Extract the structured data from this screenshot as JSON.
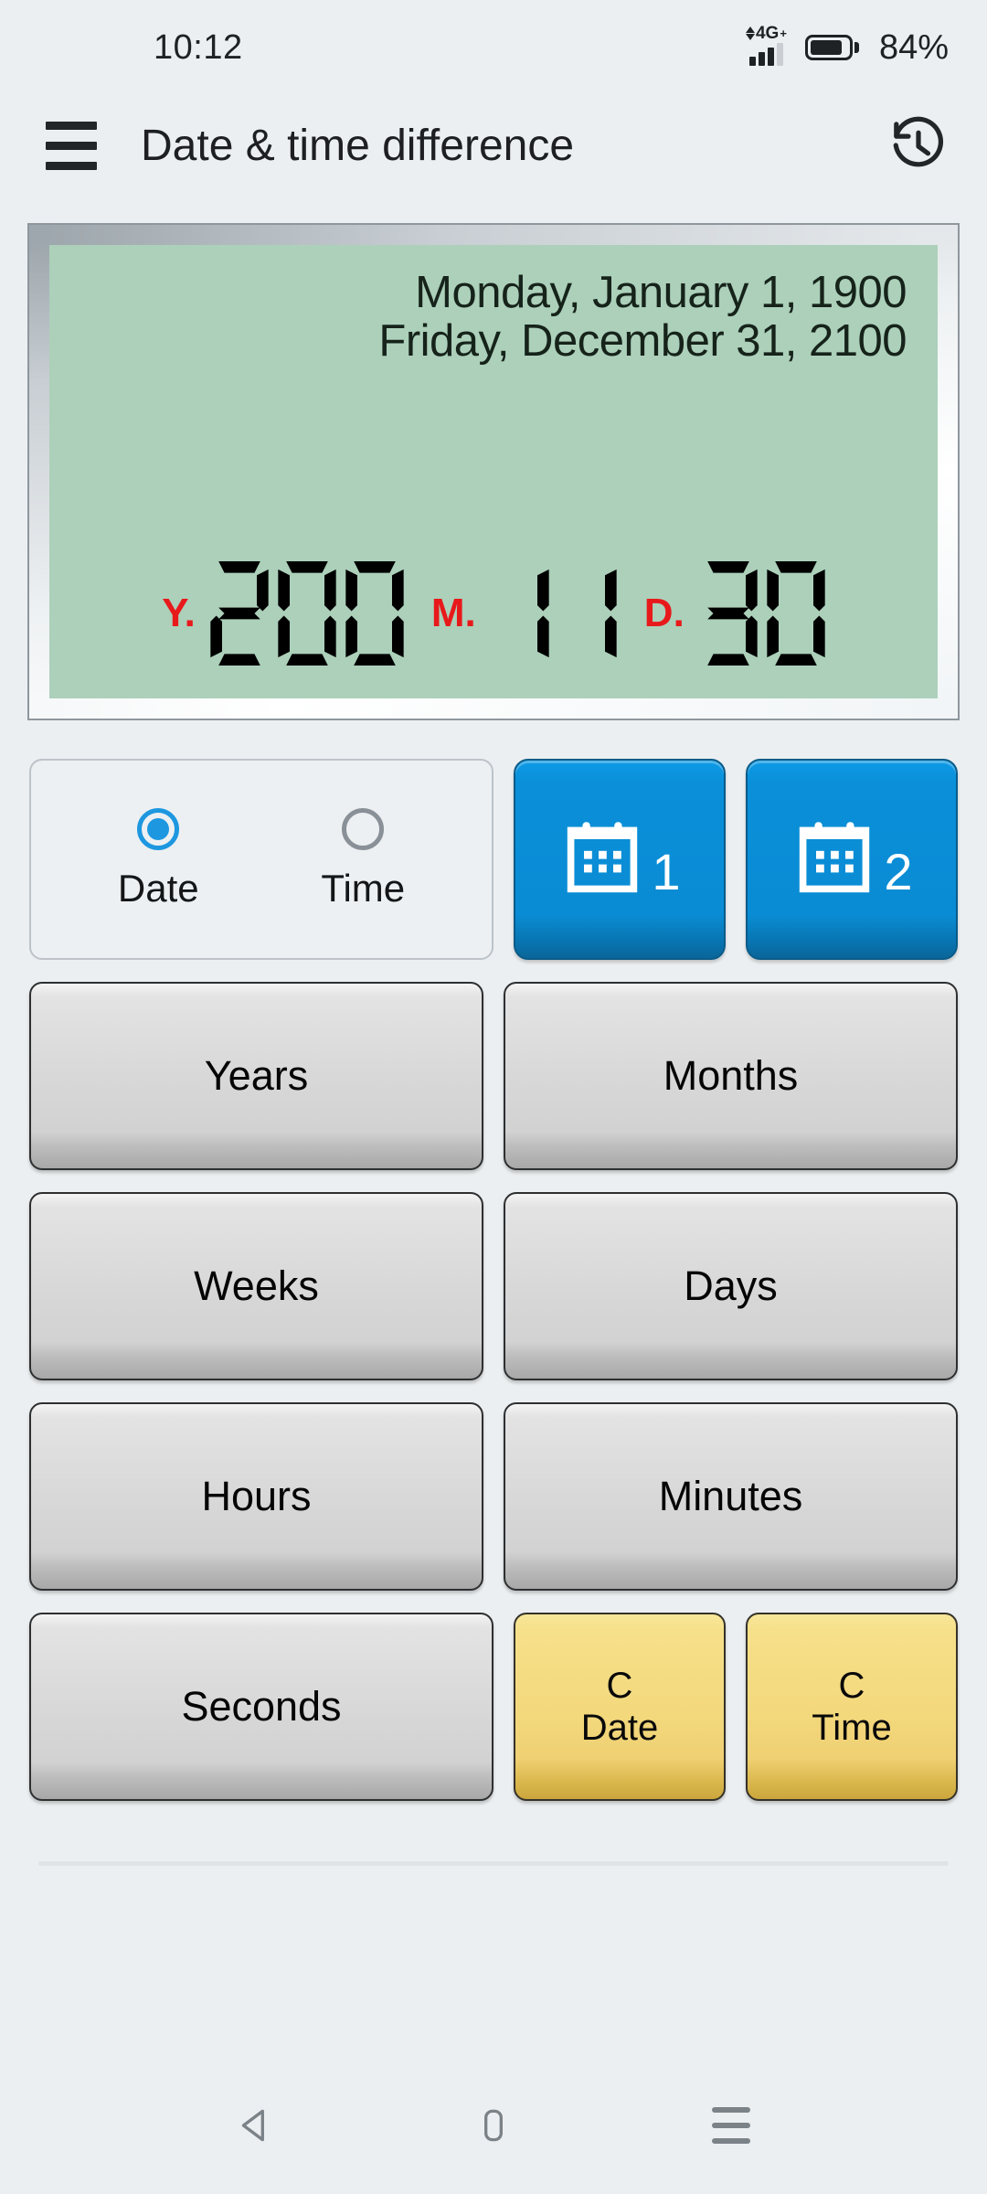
{
  "statusbar": {
    "clock": "10:12",
    "network_label": "4G",
    "network_plus": "+",
    "battery_percent": "84%",
    "battery_level": 84,
    "signal_bars_active": 3,
    "signal_bars_total": 4,
    "icons": {
      "data_arrows": "data-transfer-arrows-icon",
      "signal": "signal-bars-icon",
      "battery": "battery-icon"
    }
  },
  "appbar": {
    "menu_icon": "hamburger-menu-icon",
    "title": "Date & time difference",
    "history_icon": "history-icon"
  },
  "display": {
    "date_line_1": "Monday, January 1, 1900",
    "date_line_2": "Friday, December 31, 2100",
    "segments": [
      {
        "label": "Y.",
        "value": "200"
      },
      {
        "label": "M.",
        "value": "11"
      },
      {
        "label": "D.",
        "value": "30"
      }
    ],
    "lcd_color": "#acd0ba",
    "label_color": "#e8191b",
    "digit_color": "#000000"
  },
  "mode_selector": {
    "options": [
      {
        "label": "Date",
        "selected": true
      },
      {
        "label": "Time",
        "selected": false
      }
    ],
    "accent_color": "#1d97e0"
  },
  "calendar_buttons": [
    {
      "icon": "calendar-icon",
      "number": "1"
    },
    {
      "icon": "calendar-icon",
      "number": "2"
    }
  ],
  "unit_buttons": [
    [
      "Years",
      "Months"
    ],
    [
      "Weeks",
      "Days"
    ],
    [
      "Hours",
      "Minutes"
    ]
  ],
  "bottom_row": {
    "seconds_label": "Seconds",
    "clear_buttons": [
      {
        "line1": "C",
        "line2": "Date"
      },
      {
        "line1": "C",
        "line2": "Time"
      }
    ],
    "clear_color": "#f3d87c"
  },
  "navbar": {
    "back_icon": "back-triangle-icon",
    "home_icon": "home-square-icon",
    "recents_icon": "recents-lines-icon"
  }
}
